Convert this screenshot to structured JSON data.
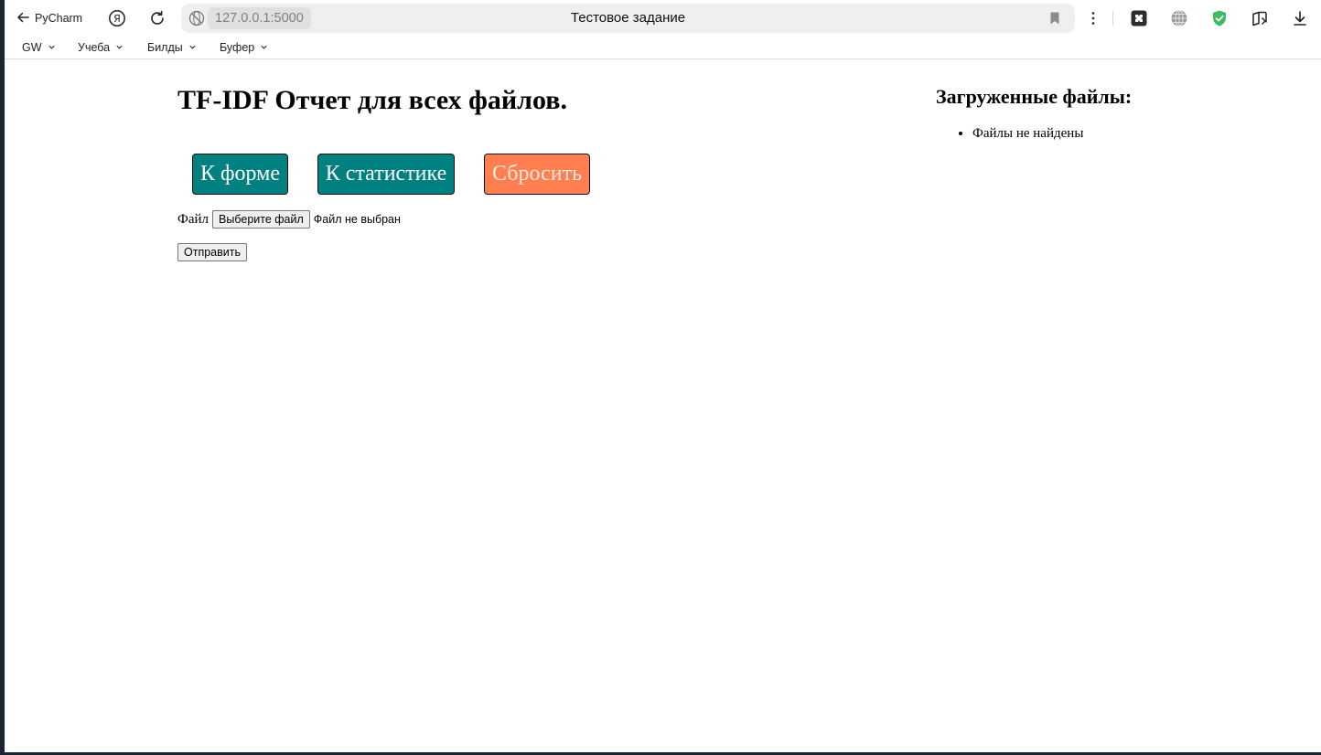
{
  "browser": {
    "back_label": "PyCharm",
    "url": "127.0.0.1:5000",
    "tab_title": "Тестовое задание",
    "shield_color": "#3dbb5e",
    "icons": {
      "back": "arrow-left-icon",
      "yandex": "yandex-logo-icon",
      "reload": "reload-icon",
      "site_info": "globe-icon",
      "bookmark": "bookmark-icon",
      "menu": "more-vertical-icon",
      "extension_1": "puzzle-extension-icon",
      "extension_2": "globe-icon",
      "extension_3": "shield-check-icon",
      "extension_4": "collections-icon",
      "download": "download-icon"
    }
  },
  "bookmarks_bar": {
    "items": [
      {
        "label": "GW"
      },
      {
        "label": "Учеба"
      },
      {
        "label": "Билды"
      },
      {
        "label": "Буфер"
      }
    ]
  },
  "page": {
    "title": "TF-IDF Отчет для всех файлов.",
    "nav_buttons": [
      {
        "label": "К форме",
        "color": "#008080"
      },
      {
        "label": "К статистике",
        "color": "#008080"
      },
      {
        "label": "Сбросить",
        "color": "#ff7f50"
      }
    ],
    "upload_form": {
      "file_label": "Файл",
      "choose_button": "Выберите файл",
      "file_status": "Файл не выбран",
      "submit_button": "Отправить"
    },
    "sidebar": {
      "title": "Загруженные файлы:",
      "items": [
        "Файлы не найдены"
      ]
    }
  }
}
